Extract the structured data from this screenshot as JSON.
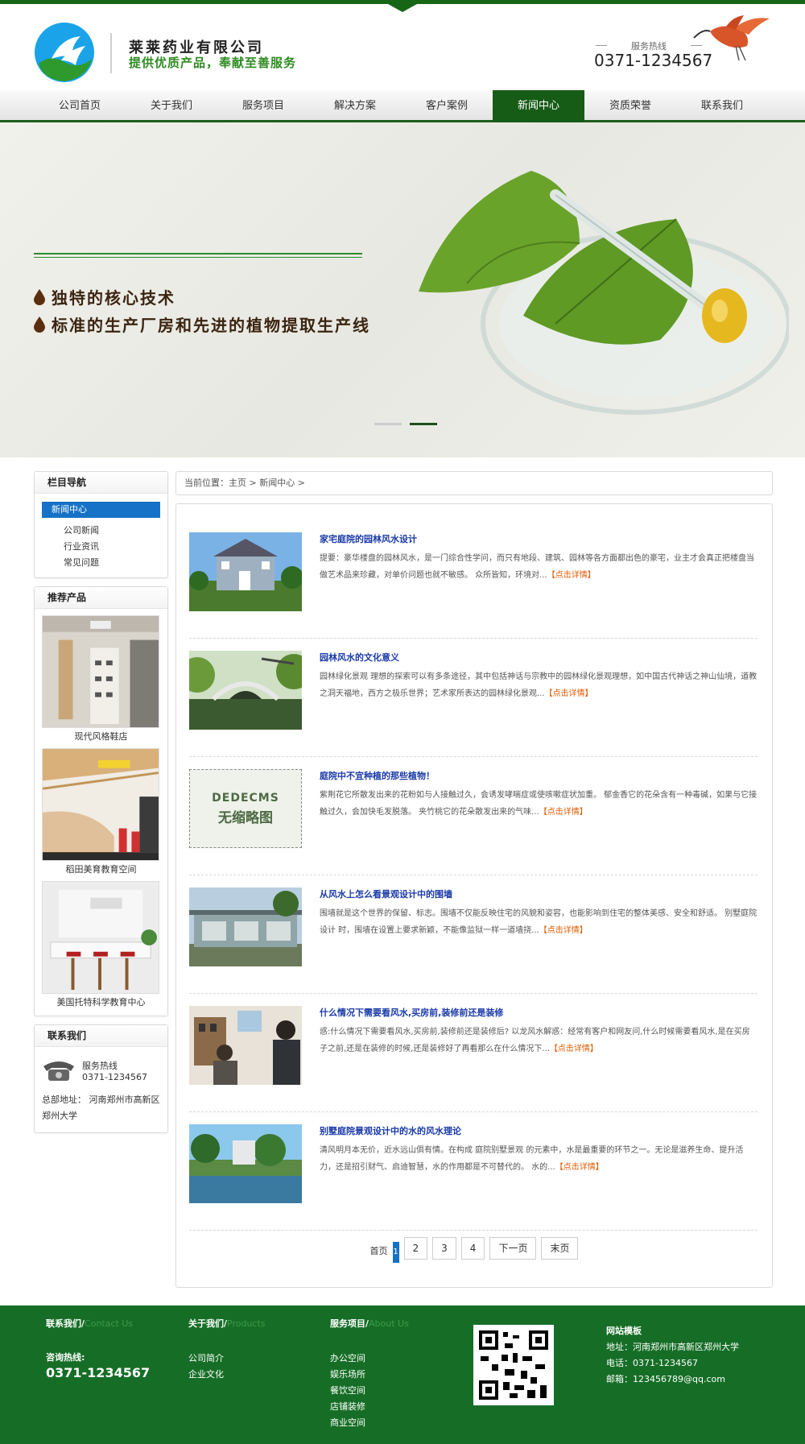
{
  "header": {
    "company_name": "莱莱药业有限公司",
    "slogan": "提供优质产品，奉献至善服务",
    "hotline_label": "服务热线",
    "hotline_number": "0371-1234567"
  },
  "nav": {
    "items": [
      {
        "label": "公司首页"
      },
      {
        "label": "关于我们"
      },
      {
        "label": "服务项目"
      },
      {
        "label": "解决方案"
      },
      {
        "label": "客户案例"
      },
      {
        "label": "新闻中心",
        "active": true
      },
      {
        "label": "资质荣誉"
      },
      {
        "label": "联系我们"
      }
    ]
  },
  "banner": {
    "line1": "独特的核心技术",
    "line2": "标准的生产厂房和先进的植物提取生产线"
  },
  "sidebar": {
    "category_title": "栏目导航",
    "category_active": "新闻中心",
    "category_items": [
      "公司新闻",
      "行业资讯",
      "常见问题"
    ],
    "products_title": "推荐产品",
    "products": [
      {
        "caption": "现代风格鞋店"
      },
      {
        "caption": "稻田美育教育空间"
      },
      {
        "caption": "美国托特科学教育中心"
      }
    ],
    "contact_title": "联系我们",
    "contact_hotline_label": "服务热线",
    "contact_hotline": "0371-1234567",
    "contact_address": "总部地址： 河南郑州市高新区郑州大学"
  },
  "breadcrumb": "当前位置：主页 > 新闻中心 >",
  "articles": [
    {
      "title": "家宅庭院的园林风水设计",
      "summary": "提要：豪华楼盘的园林风水，是一门综合性学问，而只有地段、建筑、园林等各方面都出色的豪宅，业主才会真正把楼盘当做艺术品来珍藏，对单价问题也就不敏感。 众所皆知，环境对...",
      "more": "【点击详情】"
    },
    {
      "title": "园林风水的文化意义",
      "summary": "园林绿化景观 理想的探索可以有多条途径，其中包括神话与宗教中的园林绿化景观理想，如中国古代神话之神山仙境，道教之洞天福地，西方之极乐世界；艺术家所表达的园林绿化景观...",
      "more": "【点击详情】"
    },
    {
      "title": "庭院中不宜种植的那些植物！",
      "summary": "紫荆花它所散发出来的花粉如与人接触过久，会诱发哮喘症或使咳嗽症状加重。 郁金香它的花朵含有一种毒碱，如果与它接触过久，会加快毛发脱落。 夹竹桃它的花朵散发出来的气味...",
      "more": "【点击详情】",
      "placeholder_line1": "DEDECMS",
      "placeholder_line2": "无缩略图"
    },
    {
      "title": "从风水上怎么看景观设计中的围墙",
      "summary": "围墙就是这个世界的保留、标志。围墙不仅能反映住宅的风貌和姿容，也能影响到住宅的整体美感、安全和舒适。 别墅庭院设计 时，围墙在设置上要求新颖，不能像监狱一样一道墙挠...",
      "more": "【点击详情】"
    },
    {
      "title": "什么情况下需要看风水,买房前,装修前还是装修",
      "summary": "惑:什么情况下需要看风水,买房前,装修前还是装修后? 以龙风水解惑：经常有客户和网友问,什么时候需要看风水,是在买房子之前,还是在装修的时候,还是装修好了再看那么在什么情况下...",
      "more": "【点击详情】"
    },
    {
      "title": "别墅庭院景观设计中的水的风水理论",
      "summary": "清风明月本无价，近水远山俱有情。在构成 庭院别墅景观 的元素中，水是最重要的环节之一。无论是滋养生命、提升活力，还是招引财气、启迪智慧，水的作用都是不可替代的。 水的...",
      "more": "【点击详情】"
    }
  ],
  "pager": {
    "first": "首页",
    "current": "1",
    "pages": [
      "2",
      "3",
      "4"
    ],
    "next": "下一页",
    "last": "末页"
  },
  "footer": {
    "col1_head": "联系我们/",
    "col1_en": "Contact  Us",
    "hot_label": "咨询热线:",
    "hot_number": "0371-1234567",
    "col2_head": "关于我们/",
    "col2_en": "Products",
    "col2_links": [
      "公司简介",
      "企业文化"
    ],
    "col3_head": "服务项目/",
    "col3_en": "About Us",
    "col3_links": [
      "办公空间",
      "娱乐场所",
      "餐饮空间",
      "店铺装修",
      "商业空间"
    ],
    "info_title": "网站模板",
    "info_address": "地址：河南郑州市高新区郑州大学",
    "info_phone": "电话：0371-1234567",
    "info_email": "邮箱：123456789@qq.com"
  },
  "colors": {
    "brand_green": "#166616",
    "accent_blue": "#1672c6",
    "link_more": "#e05b00"
  }
}
